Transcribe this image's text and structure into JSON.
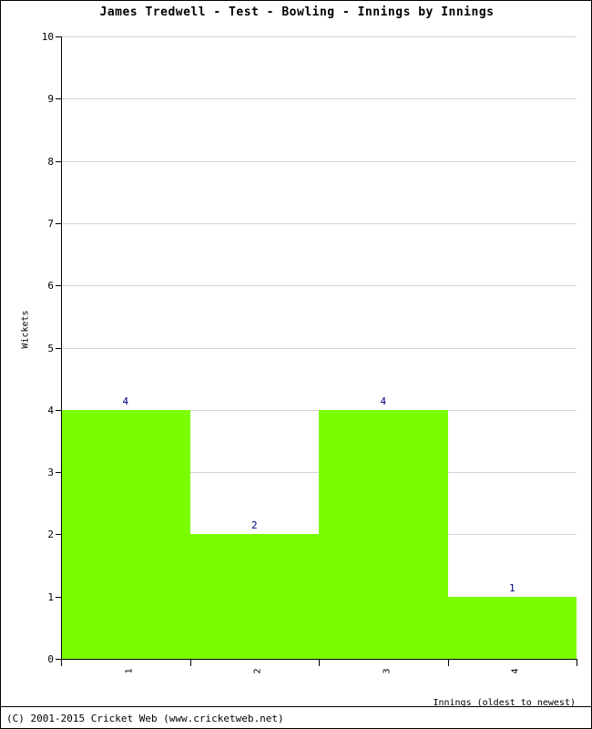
{
  "chart_data": {
    "type": "bar",
    "title": "James Tredwell - Test - Bowling - Innings by Innings",
    "xlabel": "Innings (oldest to newest)",
    "ylabel": "Wickets",
    "categories": [
      "1",
      "2",
      "3",
      "4"
    ],
    "values": [
      4,
      2,
      4,
      1
    ],
    "data_labels": [
      "4",
      "2",
      "4",
      "1"
    ],
    "ylim": [
      0,
      10
    ],
    "y_ticks": [
      0,
      1,
      2,
      3,
      4,
      5,
      6,
      7,
      8,
      9,
      10
    ],
    "y_tick_labels": [
      "0",
      "1",
      "2",
      "3",
      "4",
      "5",
      "6",
      "7",
      "8",
      "9",
      "10"
    ],
    "grid": true,
    "legend": false,
    "bar_color": "#7cfc00",
    "label_color": "#000080",
    "gridline_color": "#d4d4d4",
    "axis_color": "#000000"
  },
  "footer": {
    "copyright": "(C) 2001-2015 Cricket Web (www.cricketweb.net)"
  }
}
